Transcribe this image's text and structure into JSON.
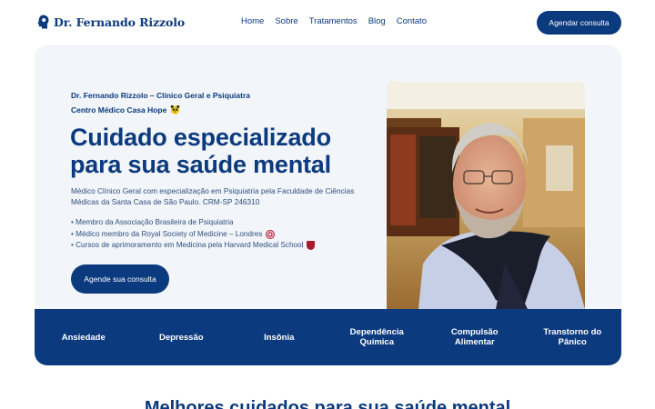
{
  "header": {
    "logo_text": "Dr. Fernando Rizzolo",
    "nav": [
      "Home",
      "Sobre",
      "Tratamentos",
      "Blog",
      "Contato"
    ],
    "cta_label": "Agendar consulta"
  },
  "hero": {
    "eyebrow_1": "Dr. Fernando Rizzolo – Clínico Geral e Psiquiatra",
    "eyebrow_2": "Centro Médico Casa Hope",
    "title": "Cuidado especializado para sua saúde mental",
    "description": "Médico Clínico Geral com especialização em Psiquiatria pela Faculdade de Ciências Médicas da Santa Casa de São Paulo. CRM-SP 246310",
    "credentials": [
      "• Membro da Associação Brasileira de Psiquiatria",
      "• Médico membro da Royal Society of Medicine – Londres",
      "• Cursos de aprimoramento em Medicina pela Harvard Medical School"
    ],
    "cta_label": "Agende sua consulta"
  },
  "conditions": [
    "Ansiedade",
    "Depressão",
    "Insônia",
    "Dependência Química",
    "Compulsão Alimentar",
    "Transtorno do Pânico"
  ],
  "next_section": {
    "title": "Melhores cuidados para sua saúde mental"
  },
  "colors": {
    "brand": "#0b3a7e",
    "hero_bg": "#f2f5f9",
    "white": "#ffffff"
  }
}
